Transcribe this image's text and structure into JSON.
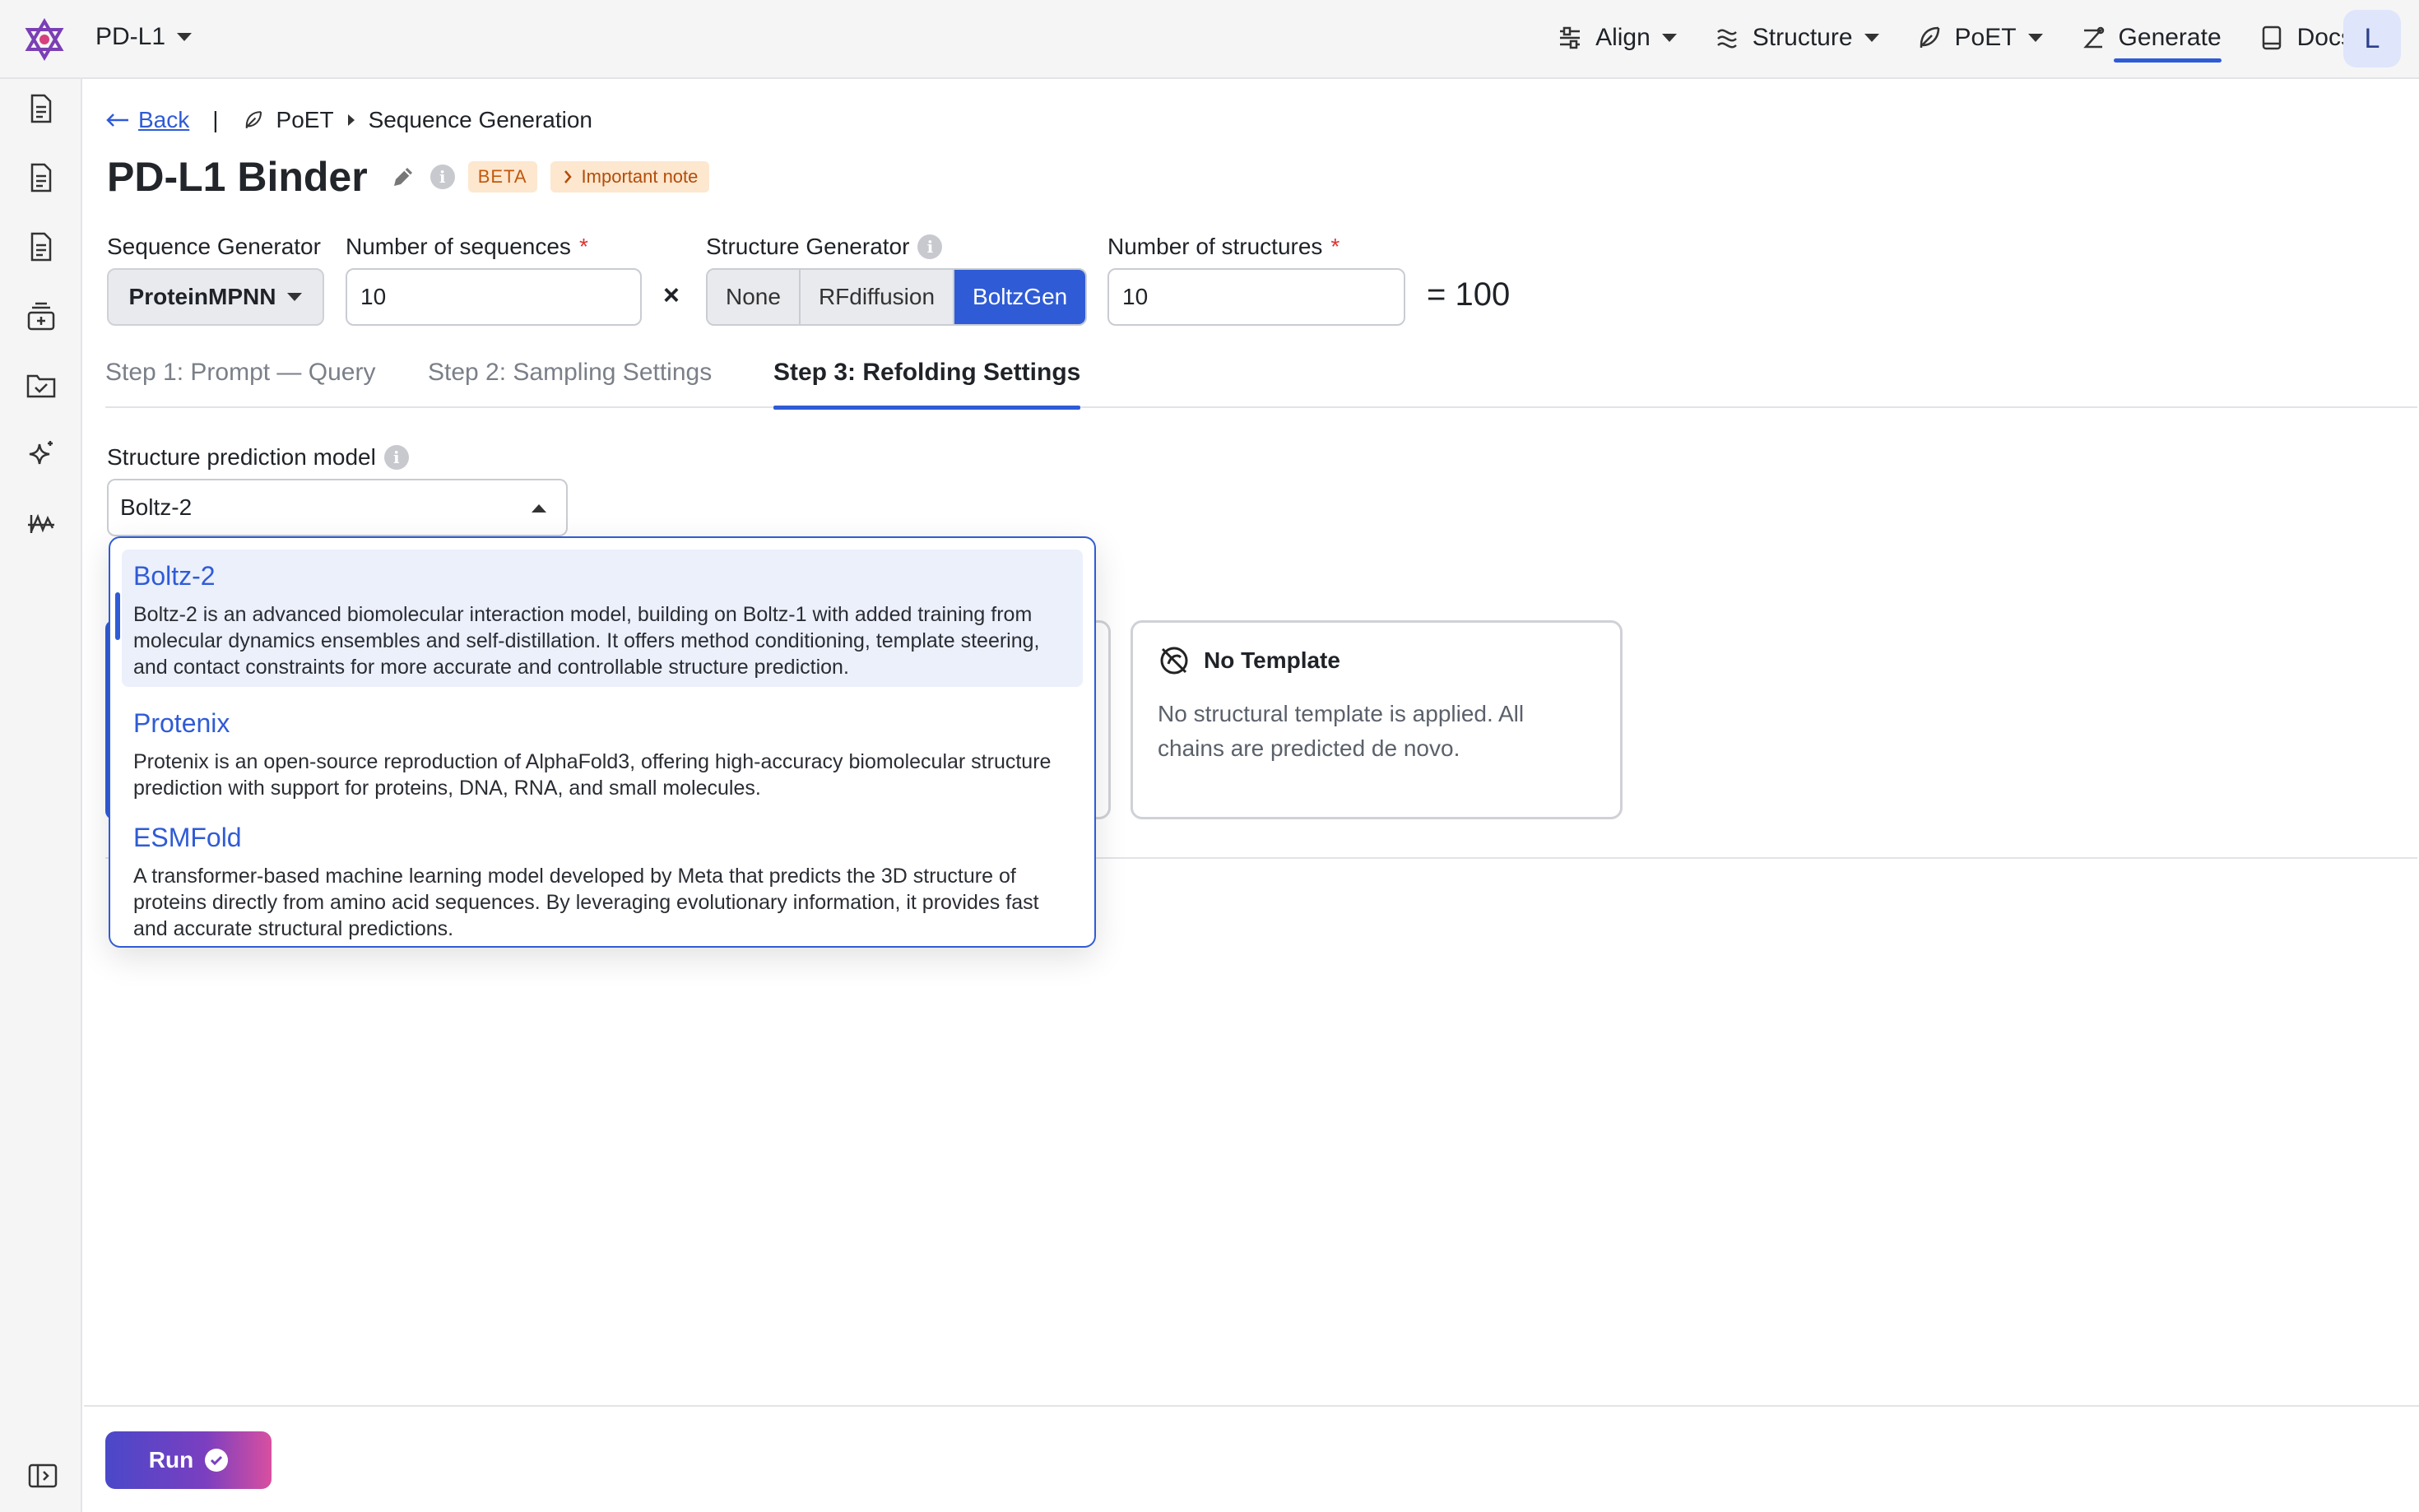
{
  "topbar": {
    "project": "PD-L1",
    "nav": [
      {
        "label": "Align",
        "icon": "align-icon",
        "dropdown": true
      },
      {
        "label": "Structure",
        "icon": "structure-icon",
        "dropdown": true
      },
      {
        "label": "PoET",
        "icon": "poet-icon",
        "dropdown": true
      },
      {
        "label": "Generate",
        "icon": "generate-icon",
        "active": true
      },
      {
        "label": "Docs",
        "icon": "book-icon"
      }
    ],
    "avatar": "L"
  },
  "sidebar": {
    "icons": [
      "document-icon",
      "document-icon",
      "document-icon",
      "dataset-icon",
      "folder-check-icon",
      "sparkle-icon",
      "waveform-icon"
    ],
    "collapse_icon": "sidebar-collapse-icon"
  },
  "breadcrumb": {
    "back": "Back",
    "separator": "|",
    "section": "PoET",
    "page": "Sequence Generation"
  },
  "header": {
    "title": "PD-L1 Binder",
    "badge": "BETA",
    "note": "Important note"
  },
  "config": {
    "sequence_generator_label": "Sequence Generator",
    "sequence_generator_value": "ProteinMPNN",
    "num_sequences_label": "Number of sequences",
    "num_sequences_value": "10",
    "times": "×",
    "structure_generator_label": "Structure Generator",
    "structure_generator_options": [
      "None",
      "RFdiffusion",
      "BoltzGen"
    ],
    "structure_generator_selected": "BoltzGen",
    "num_structures_label": "Number of structures",
    "num_structures_value": "10",
    "total": "= 100",
    "required_mark": "*"
  },
  "tabs": [
    {
      "label": "Step 1: Prompt — Query"
    },
    {
      "label": "Step 2: Sampling Settings"
    },
    {
      "label": "Step 3: Refolding Settings",
      "active": true
    }
  ],
  "refolding": {
    "model_label": "Structure prediction model",
    "model_value": "Boltz-2",
    "template_card": {
      "title": "No Template",
      "description": "No structural template is applied. All chains are predicted de novo."
    }
  },
  "dropdown": {
    "options": [
      {
        "title": "Boltz-2",
        "description": "Boltz-2 is an advanced biomolecular interaction model, building on Boltz-1 with added training from molecular dynamics ensembles and self-distillation. It offers method conditioning, template steering, and contact constraints for more accurate and controllable structure prediction.",
        "selected": true
      },
      {
        "title": "Protenix",
        "description": "Protenix is an open-source reproduction of AlphaFold3, offering high-accuracy biomolecular structure prediction with support for proteins, DNA, RNA, and small molecules."
      },
      {
        "title": "ESMFold",
        "description": "A transformer-based machine learning model developed by Meta that predicts the 3D structure of proteins directly from amino acid sequences. By leveraging evolutionary information, it provides fast and accurate structural predictions."
      }
    ]
  },
  "footer": {
    "run": "Run"
  },
  "colors": {
    "accent": "#2f5bd6",
    "badge_bg": "#fde7cf",
    "badge_text": "#c2580d"
  }
}
